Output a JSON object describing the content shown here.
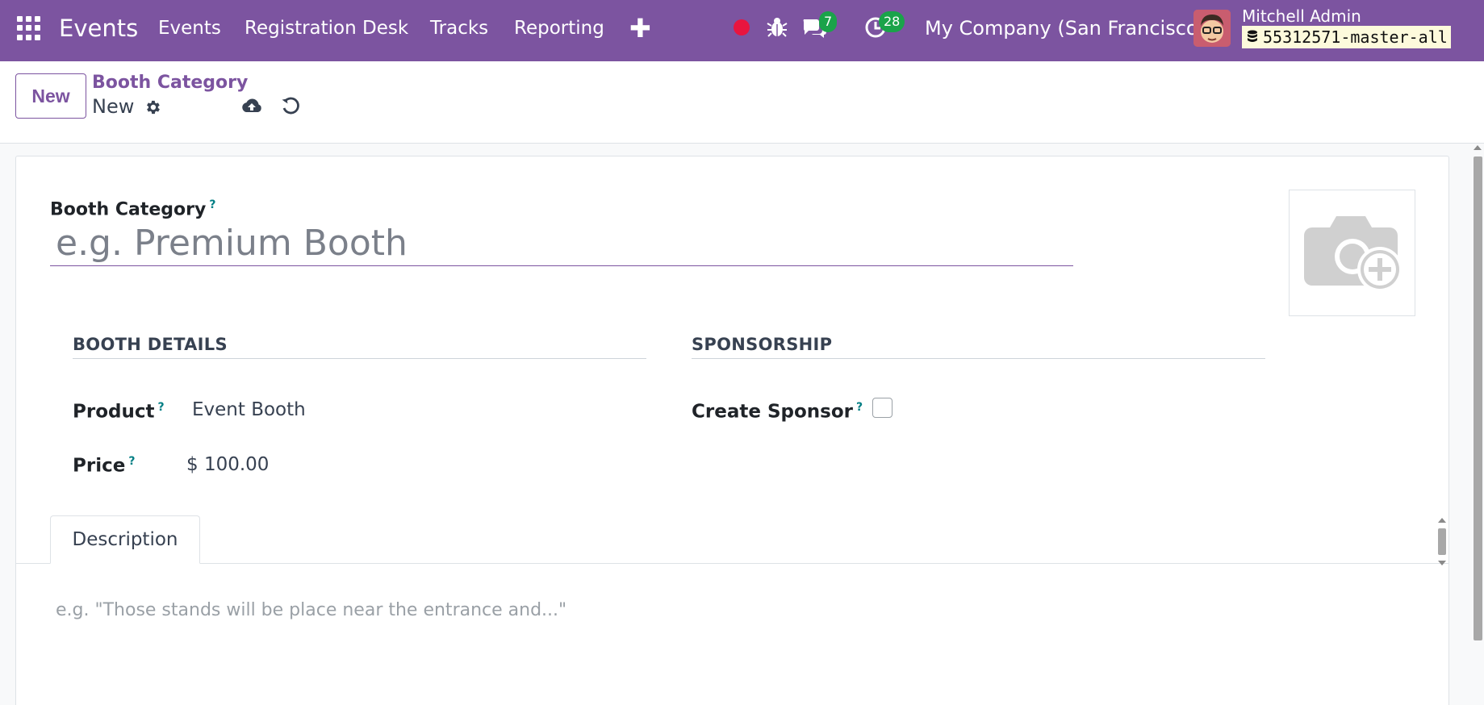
{
  "navbar": {
    "app_name": "Events",
    "menu": [
      "Events",
      "Registration Desk",
      "Tracks",
      "Reporting"
    ],
    "messages_count": "7",
    "activities_count": "28",
    "company": "My Company (San Francisco)",
    "user_name": "Mitchell Admin",
    "database": "55312571-master-all",
    "colors": {
      "bar": "#7c54a0",
      "recording": "#e8153f",
      "badge": "#1aa34a"
    }
  },
  "control": {
    "new_label": "New",
    "breadcrumb_parent": "Booth Category",
    "breadcrumb_current": "New"
  },
  "form": {
    "name_label": "Booth Category",
    "help_mark": "?",
    "name_placeholder": "e.g. Premium Booth",
    "booth_details_title": "BOOTH DETAILS",
    "sponsorship_title": "SPONSORSHIP",
    "product_label": "Product",
    "product_value": "Event Booth",
    "price_label": "Price",
    "price_value": "$ 100.00",
    "create_sponsor_label": "Create Sponsor",
    "create_sponsor_checked": false
  },
  "tabs": {
    "description_label": "Description",
    "description_placeholder": "e.g. \"Those stands will be place near the entrance and...\""
  }
}
